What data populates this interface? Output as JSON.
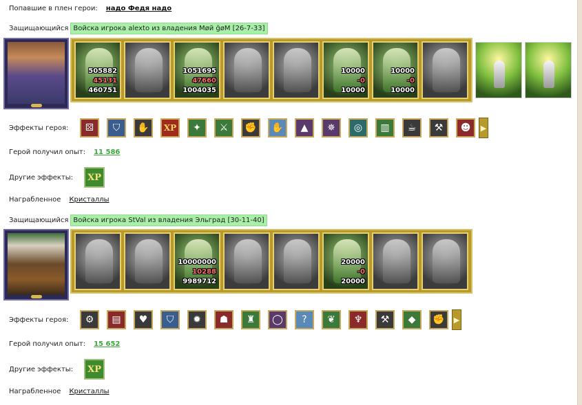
{
  "captured": {
    "label": "Попавшие в плен герои:",
    "names": "надо Федя надо"
  },
  "battles": [
    {
      "defender_label": "Защищающийся",
      "defender_text": "Войска игрока alexto из владения Møй ğøM [26-7-33]",
      "units": [
        {
          "style": "color",
          "n1": "505882",
          "n2": "45131",
          "n3": "460751"
        },
        {
          "style": "gray",
          "n1": "",
          "n2": "",
          "n3": ""
        },
        {
          "style": "color",
          "n1": "1051695",
          "n2": "47660",
          "n3": "1004035"
        },
        {
          "style": "gray",
          "n1": "",
          "n2": "",
          "n3": ""
        },
        {
          "style": "gray",
          "n1": "",
          "n2": "",
          "n3": ""
        },
        {
          "style": "color",
          "n1": "10000",
          "n2": "-0",
          "n3": "10000"
        },
        {
          "style": "color",
          "n1": "10000",
          "n2": "-0",
          "n3": "10000"
        },
        {
          "style": "gray",
          "n1": "",
          "n2": "",
          "n3": ""
        }
      ],
      "extras": 2,
      "effects_label": "Эффекты героя:",
      "effects": [
        {
          "icon": "dice-icon",
          "cls": "red",
          "glyph": "⚄"
        },
        {
          "icon": "shield-icon",
          "cls": "blue",
          "glyph": "⛉"
        },
        {
          "icon": "handshake-shield-icon",
          "cls": "dark",
          "glyph": "✋"
        },
        {
          "icon": "xp-icon",
          "cls": "xp",
          "glyph": "XP"
        },
        {
          "icon": "xp-figure-icon",
          "cls": "green",
          "glyph": "✦"
        },
        {
          "icon": "sword-icon",
          "cls": "green",
          "glyph": "⚔"
        },
        {
          "icon": "handshake-icon",
          "cls": "dark",
          "glyph": "✊"
        },
        {
          "icon": "hand-crystal-icon",
          "cls": "bright",
          "glyph": "✋"
        },
        {
          "icon": "hood-icon",
          "cls": "purple",
          "glyph": "▲"
        },
        {
          "icon": "crest-icon",
          "cls": "purple",
          "glyph": "✵"
        },
        {
          "icon": "coin-icon",
          "cls": "teal",
          "glyph": "◎"
        },
        {
          "icon": "scroll-icon",
          "cls": "green",
          "glyph": "▥"
        },
        {
          "icon": "mug-icon",
          "cls": "dark",
          "glyph": "☕"
        },
        {
          "icon": "axe-icon",
          "cls": "dark",
          "glyph": "⚒"
        },
        {
          "icon": "face-shield-icon",
          "cls": "red",
          "glyph": "☻"
        }
      ],
      "exp_label": "Герой получил опыт:",
      "exp_value": "11 586",
      "other_label": "Другие эффекты:",
      "other_xp": "XP",
      "loot_label": "Награбленное",
      "loot_value": "Кристаллы"
    },
    {
      "defender_label": "Защищающийся",
      "defender_text": "Войска игрока StVal из владения Эльград [30-11-40]",
      "units": [
        {
          "style": "gray",
          "n1": "",
          "n2": "",
          "n3": ""
        },
        {
          "style": "gray",
          "n1": "",
          "n2": "",
          "n3": ""
        },
        {
          "style": "color",
          "n1": "10000000",
          "n2": "10288",
          "n3": "9989712"
        },
        {
          "style": "gray",
          "n1": "",
          "n2": "",
          "n3": ""
        },
        {
          "style": "gray",
          "n1": "",
          "n2": "",
          "n3": ""
        },
        {
          "style": "color",
          "n1": "20000",
          "n2": "-0",
          "n3": "20000"
        },
        {
          "style": "gray",
          "n1": "",
          "n2": "",
          "n3": ""
        },
        {
          "style": "gray",
          "n1": "",
          "n2": "",
          "n3": ""
        }
      ],
      "extras": 0,
      "effects_label": "Эффекты героя:",
      "effects": [
        {
          "icon": "armor-icon",
          "cls": "dark",
          "glyph": "⚙"
        },
        {
          "icon": "books-icon",
          "cls": "red",
          "glyph": "▤"
        },
        {
          "icon": "heart-icon",
          "cls": "dark",
          "glyph": "♥"
        },
        {
          "icon": "shield-icon",
          "cls": "blue",
          "glyph": "⛉"
        },
        {
          "icon": "flame-rune-icon",
          "cls": "dark",
          "glyph": "✹"
        },
        {
          "icon": "mask-icon",
          "cls": "red",
          "glyph": "☗"
        },
        {
          "icon": "gold-armor-icon",
          "cls": "green",
          "glyph": "♜"
        },
        {
          "icon": "ring-icon",
          "cls": "purple",
          "glyph": "◯"
        },
        {
          "icon": "question-icon",
          "cls": "bright",
          "glyph": "?"
        },
        {
          "icon": "leaf-icon",
          "cls": "green",
          "glyph": "❦"
        },
        {
          "icon": "wing-icon",
          "cls": "red",
          "glyph": "♆"
        },
        {
          "icon": "hammer-icon",
          "cls": "dark",
          "glyph": "⚒"
        },
        {
          "icon": "crystal-icon",
          "cls": "green",
          "glyph": "◆"
        },
        {
          "icon": "gauntlet-icon",
          "cls": "dark",
          "glyph": "✊"
        }
      ],
      "exp_label": "Герой получил опыт:",
      "exp_value": "15 652",
      "other_label": "Другие эффекты:",
      "other_xp": "XP",
      "loot_label": "Награбленное",
      "loot_value": "Кристаллы"
    }
  ]
}
